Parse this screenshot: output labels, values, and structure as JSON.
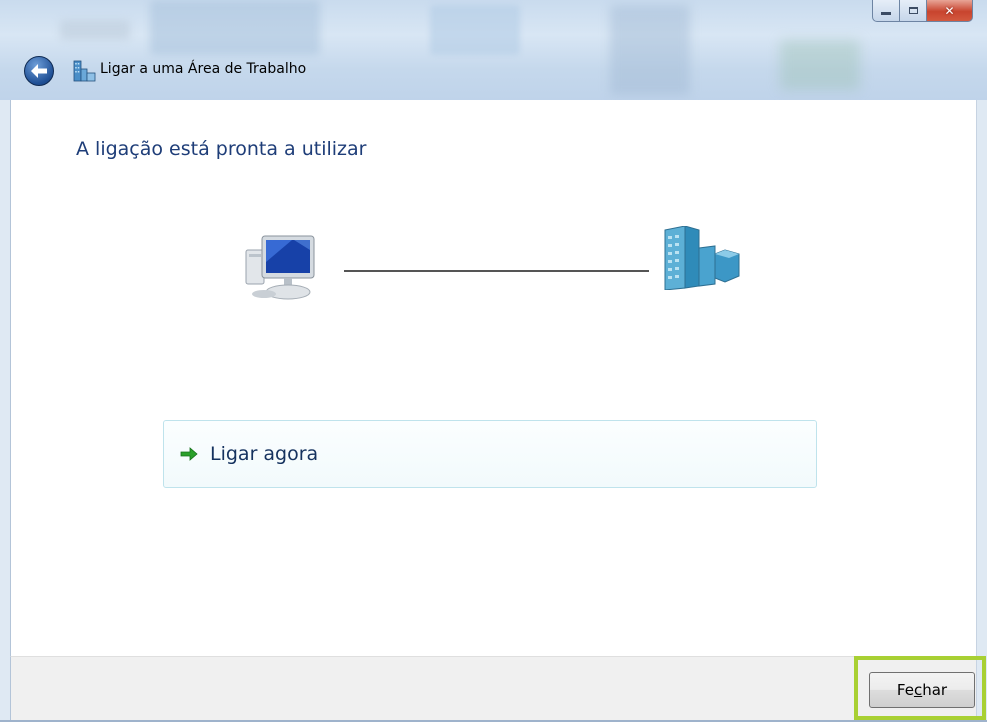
{
  "window": {
    "title": "Ligar a uma Área de Trabalho"
  },
  "content": {
    "heading": "A ligação está pronta a utilizar",
    "command_link": {
      "label": "Ligar agora",
      "icon": "green-arrow-icon"
    },
    "icons": {
      "left": "computer-icon",
      "right": "server-icon"
    }
  },
  "footer": {
    "close_button": {
      "pre": "Fe",
      "accel": "c",
      "post": "har"
    }
  },
  "colors": {
    "heading": "#1e3d78",
    "highlight": "#a8d033",
    "command_border": "#bfe3ec"
  }
}
